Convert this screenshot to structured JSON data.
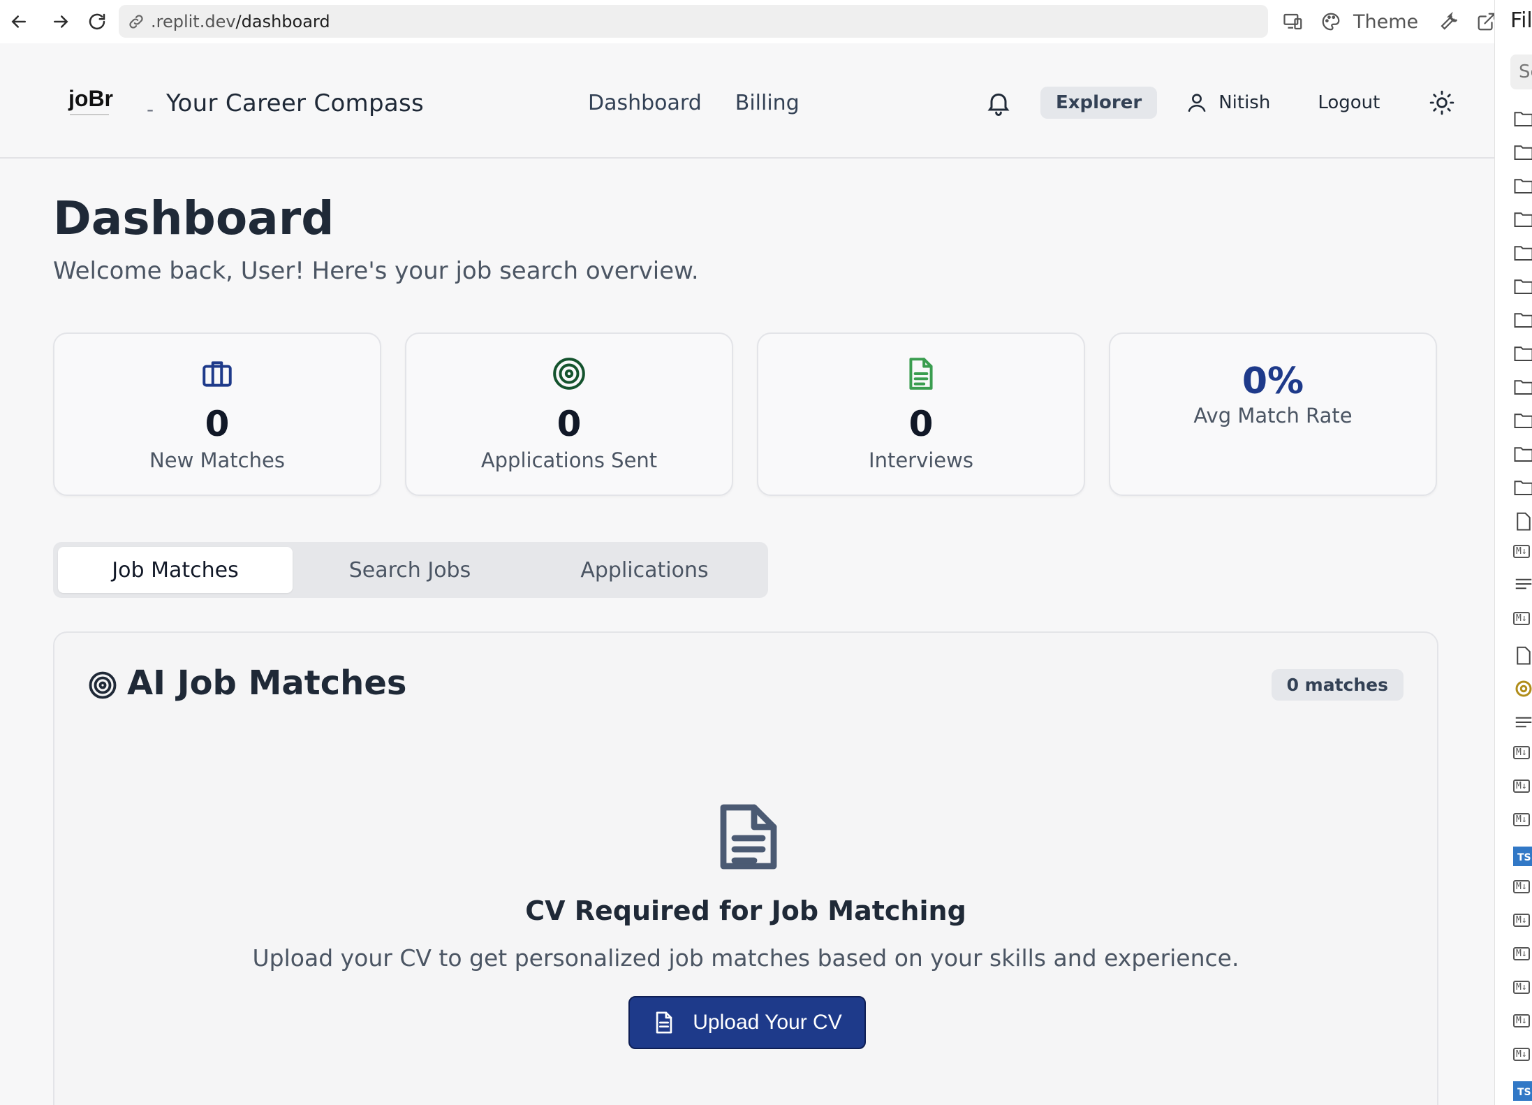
{
  "browser": {
    "url_host": ".replit.dev",
    "url_path": "/dashboard",
    "theme_label": "Theme"
  },
  "file_panel": {
    "title": "Fil",
    "search_placeholder": "Se"
  },
  "header": {
    "logo_text": "joBr",
    "separator": "-",
    "tagline": "Your Career Compass",
    "nav": [
      "Dashboard",
      "Billing"
    ],
    "plan_badge": "Explorer",
    "user_name": "Nitish",
    "logout_label": "Logout"
  },
  "page": {
    "title": "Dashboard",
    "subtitle": "Welcome back, User! Here's your job search overview."
  },
  "stats": [
    {
      "icon": "briefcase-icon",
      "value": "0",
      "label": "New Matches",
      "color": "#1e3a8a"
    },
    {
      "icon": "target-icon",
      "value": "0",
      "label": "Applications Sent",
      "color": "#14532d"
    },
    {
      "icon": "document-icon",
      "value": "0",
      "label": "Interviews",
      "color": "#3a9d4f"
    },
    {
      "value": "0%",
      "label": "Avg Match Rate",
      "color": "#1e3a8a"
    }
  ],
  "tabs": [
    "Job Matches",
    "Search Jobs",
    "Applications"
  ],
  "active_tab": "Job Matches",
  "matches": {
    "title": "AI Job Matches",
    "count_badge": "0 matches",
    "empty_title": "CV Required for Job Matching",
    "empty_text": "Upload your CV to get personalized job matches based on your skills and experience.",
    "upload_label": "Upload Your CV"
  },
  "colors": {
    "accent": "#1e3a8a",
    "background": "#f7f7f8",
    "card_border": "#e3e4e8"
  }
}
